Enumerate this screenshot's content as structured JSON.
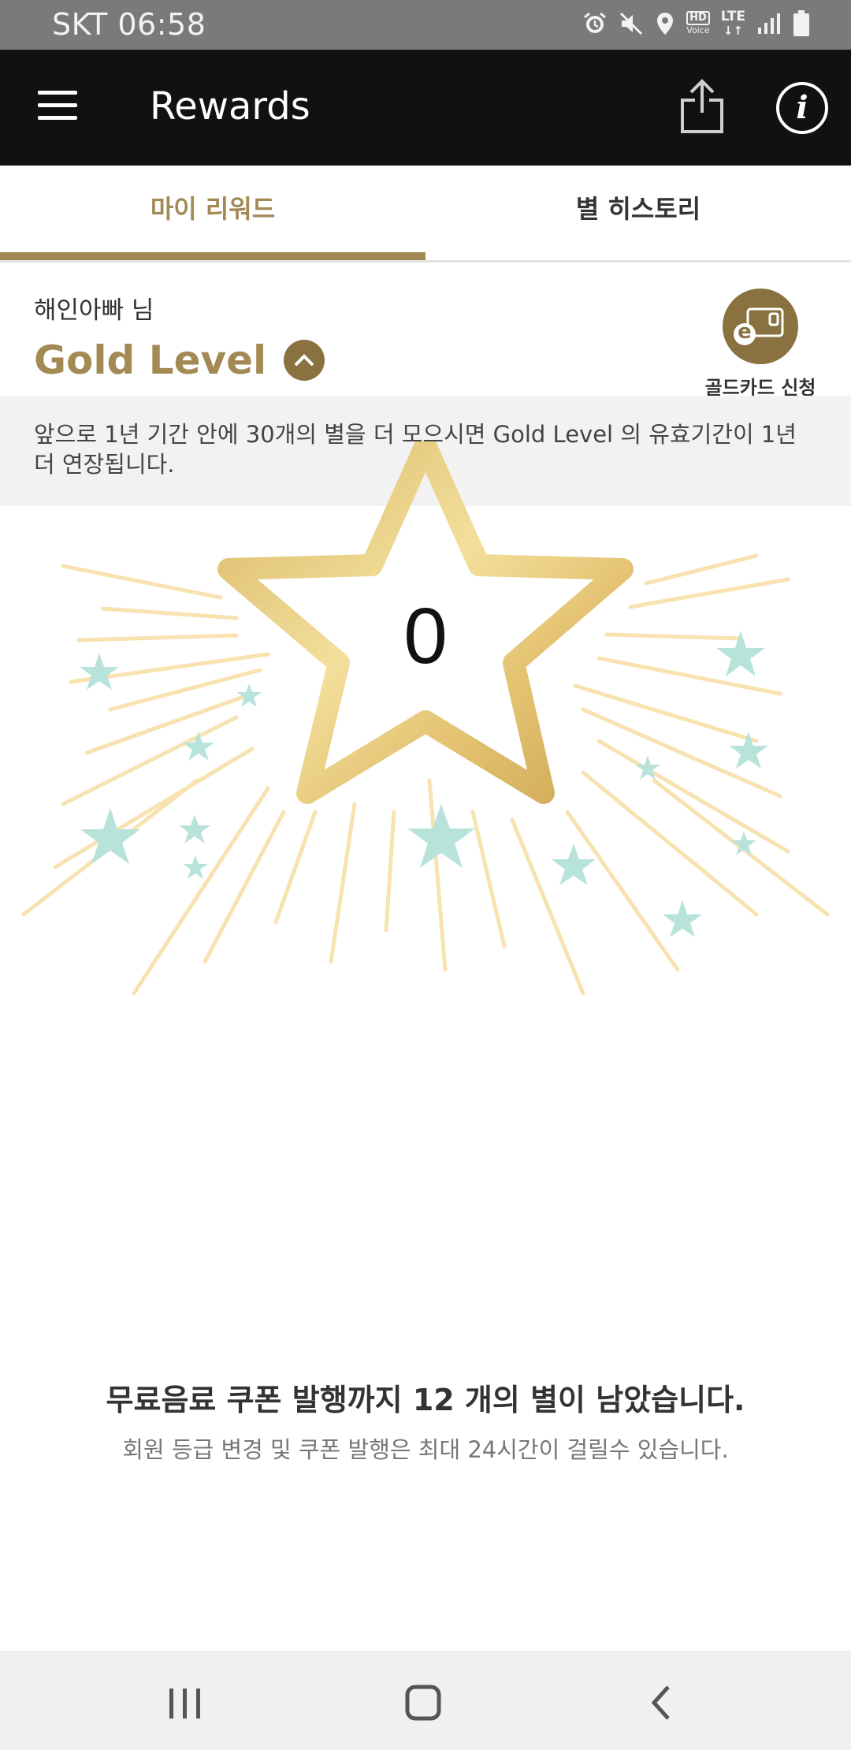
{
  "status_bar": {
    "carrier_time": "SKT 06:58",
    "hd_label": "HD",
    "voice_label": "Voice",
    "network_label": "LTE",
    "icons": [
      "alarm-icon",
      "mute-icon",
      "location-icon",
      "hd-voice-icon",
      "lte-icon",
      "signal-icon",
      "battery-icon"
    ]
  },
  "app_bar": {
    "title": "Rewards",
    "icons": [
      "menu-icon",
      "share-icon",
      "info-icon"
    ],
    "info_glyph": "i"
  },
  "tabs": [
    {
      "label": "마이 리워드",
      "active": true
    },
    {
      "label": "별 히스토리",
      "active": false
    }
  ],
  "profile": {
    "user_name": "해인아빠 님",
    "level_name": "Gold Level",
    "gold_card_label": "골드카드 신청",
    "gold_card_glyph": "e"
  },
  "notice": {
    "text": "앞으로 1년 기간 안에 30개의 별을 더 모으시면 Gold Level 의 유효기간이 1년 더 연장됩니다."
  },
  "stars": {
    "count": "0"
  },
  "coupon": {
    "remaining_text": "무료음료 쿠폰 발행까지 12 개의 별이 남았습니다.",
    "sub_text": "회원 등급 변경 및 쿠폰 발행은 최대 24시간이 걸릴수 있습니다."
  },
  "colors": {
    "accent_gold": "#a38a55",
    "dark_gold": "#8a7240",
    "app_bar": "#111111",
    "status_bar": "#7a7a7a",
    "mint_star": "#b8e3da",
    "ray": "#f7dfa8"
  },
  "nav_bar": {
    "icons": [
      "recent-apps-icon",
      "home-icon",
      "back-icon"
    ]
  }
}
